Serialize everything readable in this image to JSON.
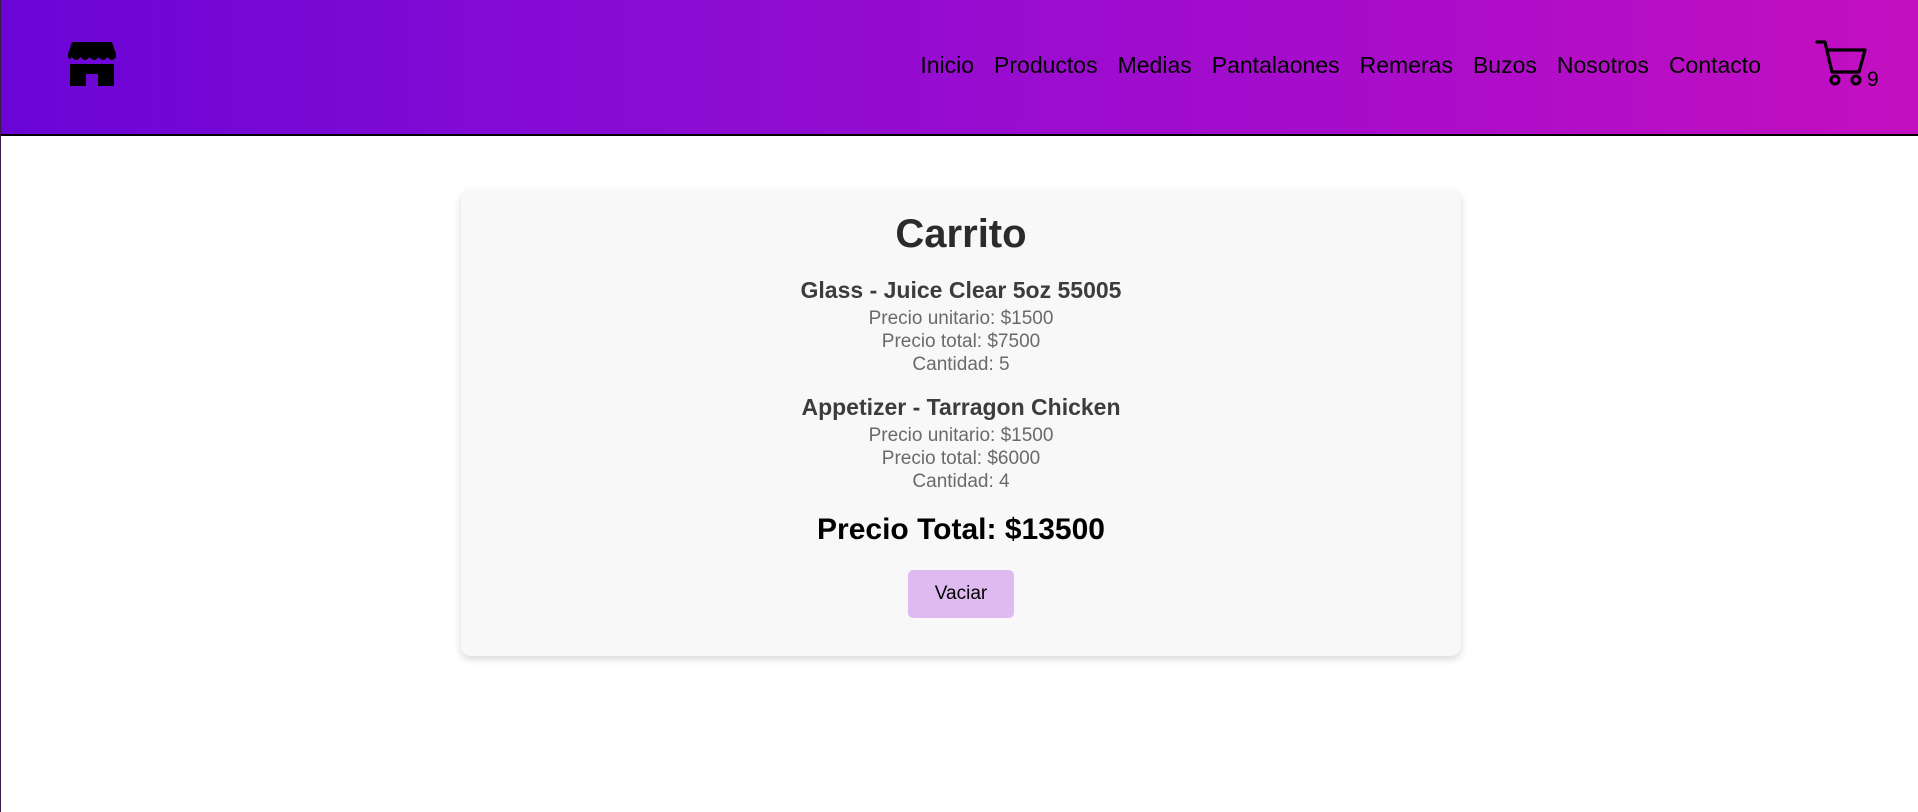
{
  "header": {
    "logo_icon": "storefront-icon",
    "nav": [
      {
        "label": "Inicio"
      },
      {
        "label": "Productos"
      },
      {
        "label": "Medias"
      },
      {
        "label": "Pantalaones"
      },
      {
        "label": "Remeras"
      },
      {
        "label": "Buzos"
      },
      {
        "label": "Nosotros"
      },
      {
        "label": "Contacto"
      }
    ],
    "cart_icon": "cart-icon",
    "cart_count": "9",
    "gradient_start": "#6a05d6",
    "gradient_end": "#c40fc0"
  },
  "cart": {
    "title": "Carrito",
    "items": [
      {
        "name": "Glass - Juice Clear 5oz 55005",
        "unit_price": "Precio unitario: $1500",
        "total_price": "Precio total: $7500",
        "quantity": "Cantidad: 5"
      },
      {
        "name": "Appetizer - Tarragon Chicken",
        "unit_price": "Precio unitario: $1500",
        "total_price": "Precio total: $6000",
        "quantity": "Cantidad: 4"
      }
    ],
    "grand_total": "Precio Total: $13500",
    "empty_button": "Vaciar",
    "button_color": "#debaf0"
  }
}
